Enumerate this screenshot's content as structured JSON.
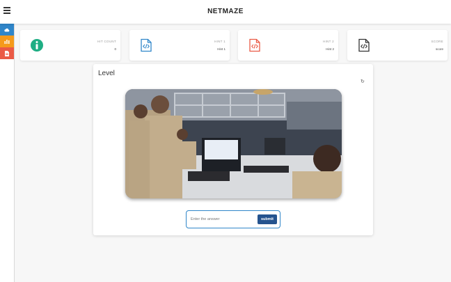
{
  "header": {
    "title": "NETMAZE",
    "menu_icon": "hamburger-icon"
  },
  "sidebar": {
    "items": [
      {
        "name": "cloud-icon",
        "color": "#2f86c9"
      },
      {
        "name": "chart-icon",
        "color": "#f59a1b"
      },
      {
        "name": "file-icon",
        "color": "#ea5a45"
      }
    ]
  },
  "cards": [
    {
      "label": "HIT COUNT",
      "value": "0",
      "icon": "info-icon",
      "color": "#1fae84"
    },
    {
      "label": "HINT 1",
      "value": "Hint 1",
      "icon": "code-file-icon",
      "color": "#2f86c9"
    },
    {
      "label": "HINT 2",
      "value": "Hint 2",
      "icon": "code-file-icon",
      "color": "#ea5a45"
    },
    {
      "label": "SCORE",
      "value": "score",
      "icon": "code-file-icon",
      "color": "#333333"
    }
  ],
  "level": {
    "title": "Level",
    "refresh_icon": "refresh-icon",
    "image_alt": "control-room-photo",
    "answer_placeholder": "Enter the answer",
    "submit_label": "submit"
  }
}
